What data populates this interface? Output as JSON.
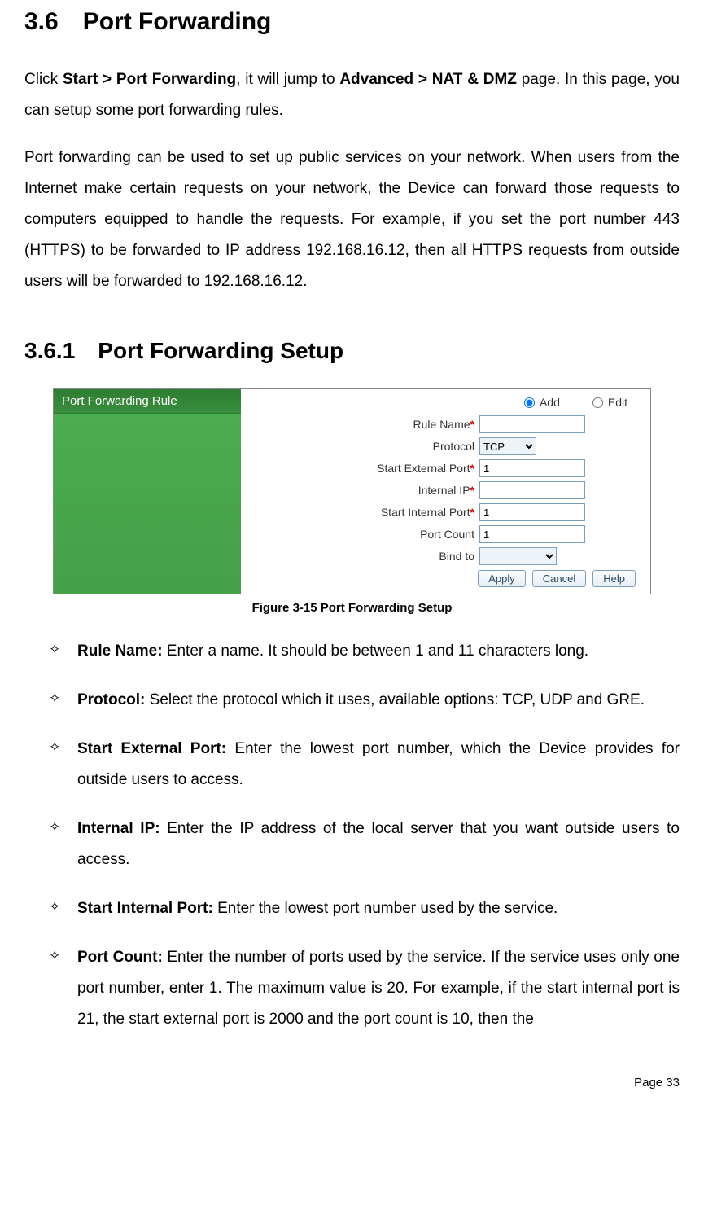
{
  "headings": {
    "h1": "3.6 Port Forwarding",
    "h2": "3.6.1 Port Forwarding Setup"
  },
  "paragraphs": {
    "p1_pre": "Click ",
    "p1_b1": "Start > Port Forwarding",
    "p1_mid": ", it will jump to ",
    "p1_b2": "Advanced > NAT & DMZ",
    "p1_post": " page. In this page, you can setup some port forwarding rules.",
    "p2": "Port forwarding can be used to set up public services on your network. When users from the Internet make certain requests on your network, the Device can forward those requests to computers equipped to handle the requests. For example, if you set the port number 443 (HTTPS) to be forwarded to IP address 192.168.16.12, then all HTTPS requests from outside users will be forwarded to 192.168.16.12."
  },
  "screenshot": {
    "panel_title": "Port Forwarding Rule",
    "radios": {
      "add": "Add",
      "edit": "Edit"
    },
    "labels": {
      "rule_name": "Rule Name",
      "protocol": "Protocol",
      "start_ext": "Start External Port",
      "internal_ip": "Internal IP",
      "start_int": "Start Internal Port",
      "port_count": "Port Count",
      "bind_to": "Bind to"
    },
    "values": {
      "rule_name": "",
      "protocol": "TCP",
      "start_ext": "1",
      "internal_ip": "",
      "start_int": "1",
      "port_count": "1",
      "bind_to": ""
    },
    "buttons": {
      "apply": "Apply",
      "cancel": "Cancel",
      "help": "Help"
    }
  },
  "caption": "Figure 3-15 Port Forwarding Setup",
  "bullets": [
    {
      "label": "Rule Name:",
      "text": " Enter a name. It should be between 1 and 11 characters long."
    },
    {
      "label": "Protocol:",
      "text": " Select the protocol which it uses, available options: TCP, UDP and GRE."
    },
    {
      "label": "Start External Port:",
      "text": " Enter the lowest port number, which the Device provides for outside users to access."
    },
    {
      "label": "Internal IP:",
      "text": " Enter the IP address of the local server that you want outside users to access."
    },
    {
      "label": "Start Internal Port:",
      "text": " Enter the lowest port number used by the service."
    },
    {
      "label": "Port Count:",
      "text": " Enter the number of ports used by the service. If the service uses only one port number, enter 1. The maximum value is 20. For example, if the start internal port is 21, the start external port is 2000 and the port count is 10, then the"
    }
  ],
  "footer": "Page 33"
}
